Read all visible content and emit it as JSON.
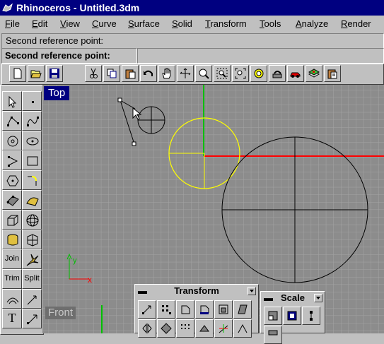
{
  "titlebar": {
    "title": "Rhinoceros - Untitled.3dm"
  },
  "menu": [
    "File",
    "Edit",
    "View",
    "Curve",
    "Surface",
    "Solid",
    "Transform",
    "Tools",
    "Analyze",
    "Render"
  ],
  "command": {
    "history": "Second reference point:",
    "prompt": "Second reference point:"
  },
  "viewports": {
    "top": "Top",
    "front": "Front"
  },
  "left_tools": {
    "join": "Join",
    "trim": "Trim",
    "split": "Split",
    "text": "T"
  },
  "panels": {
    "transform": "Transform",
    "scale": "Scale"
  },
  "colors": {
    "title_bg": "#000080",
    "x_axis": "#ff0000",
    "y_axis": "#00c000",
    "selection": "#ffff00"
  }
}
